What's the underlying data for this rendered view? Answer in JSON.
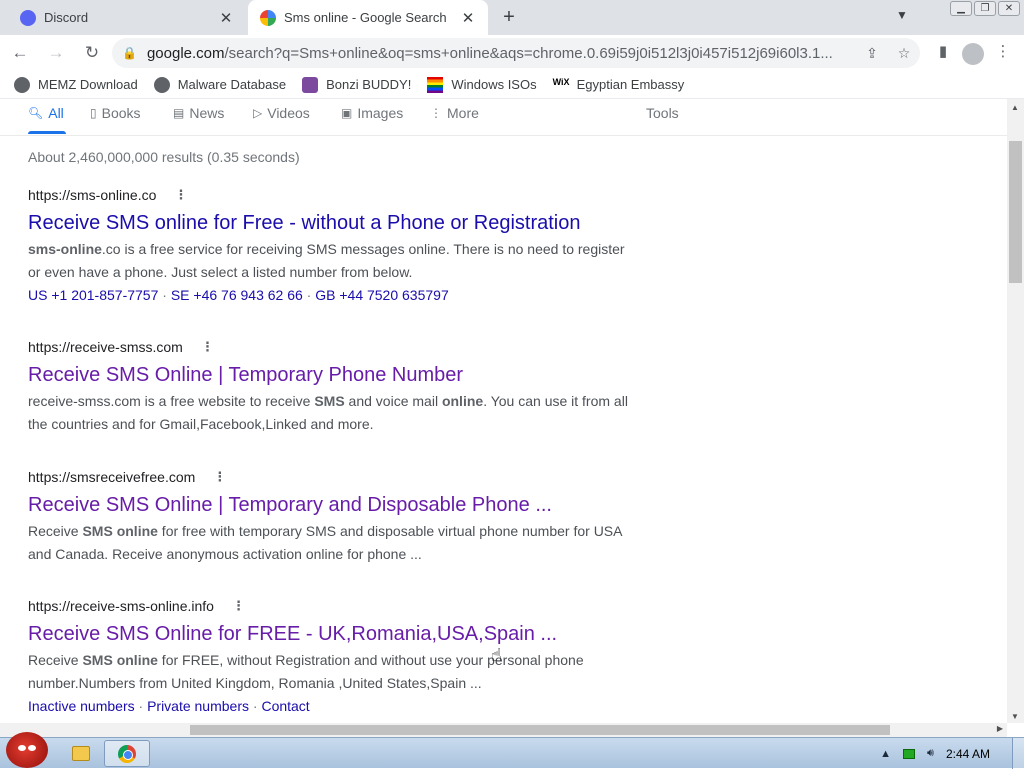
{
  "browser": {
    "tabs": [
      {
        "title": "Discord",
        "icon": "discord-icon",
        "active": false
      },
      {
        "title": "Sms online - Google Search",
        "icon": "google-icon",
        "active": true
      }
    ],
    "new_tab_label": "+",
    "omnibox": {
      "host": "google.com",
      "rest": "/search?q=Sms+online&oq=sms+online&aqs=chrome.0.69i59j0i512l3j0i457i512j69i60l3.1..."
    },
    "bookmarks": [
      {
        "label": "MEMZ Download",
        "icon": "globe-icon"
      },
      {
        "label": "Malware Database",
        "icon": "globe-icon"
      },
      {
        "label": "Bonzi BUDDY!",
        "icon": "bonzi-icon"
      },
      {
        "label": "Windows ISOs",
        "icon": "rainbow-flag-icon"
      },
      {
        "label": "Egyptian Embassy",
        "icon": "wix-icon",
        "icon_text": "WiX"
      }
    ]
  },
  "search": {
    "tabs": [
      {
        "label": "All",
        "icon": "search-icon",
        "selected": true
      },
      {
        "label": "Books",
        "icon": "book-icon",
        "selected": false
      },
      {
        "label": "News",
        "icon": "newspaper-icon",
        "selected": false
      },
      {
        "label": "Videos",
        "icon": "play-icon",
        "selected": false
      },
      {
        "label": "Images",
        "icon": "image-icon",
        "selected": false
      },
      {
        "label": "More",
        "icon": "more-icon",
        "selected": false
      }
    ],
    "tools_label": "Tools",
    "stats": "About 2,460,000,000 results (0.35 seconds)",
    "results": [
      {
        "cite": "https://sms-online.co",
        "title": "Receive SMS online for Free - without a Phone or Registration",
        "visited": false,
        "snippet_parts": [
          {
            "t": "sms-online",
            "b": true
          },
          {
            "t": ".co is a free service for receiving SMS messages online. There is no need to register or even have a phone. Just select a listed number from below.",
            "b": false
          }
        ],
        "sitelinks": [
          "US +1 201-857-7757",
          "SE +46 76 943 62 66",
          "GB +44 7520 635797"
        ]
      },
      {
        "cite": "https://receive-smss.com",
        "title": "Receive SMS Online | Temporary Phone Number",
        "visited": true,
        "snippet_parts": [
          {
            "t": "receive-smss.com is a free website to receive ",
            "b": false
          },
          {
            "t": "SMS",
            "b": true
          },
          {
            "t": " and voice mail ",
            "b": false
          },
          {
            "t": "online",
            "b": true
          },
          {
            "t": ". You can use it from all the countries and for Gmail,Facebook,Linked and more.",
            "b": false
          }
        ],
        "sitelinks": []
      },
      {
        "cite": "https://smsreceivefree.com",
        "title": "Receive SMS Online | Temporary and Disposable Phone ...",
        "visited": true,
        "snippet_parts": [
          {
            "t": "Receive ",
            "b": false
          },
          {
            "t": "SMS online",
            "b": true
          },
          {
            "t": " for free with temporary SMS and disposable virtual phone number for USA and Canada. Receive anonymous activation online for phone ...",
            "b": false
          }
        ],
        "sitelinks": []
      },
      {
        "cite": "https://receive-sms-online.info",
        "title": "Receive SMS Online for FREE - UK,Romania,USA,Spain ...",
        "visited": true,
        "snippet_parts": [
          {
            "t": "Receive ",
            "b": false
          },
          {
            "t": "SMS online",
            "b": true
          },
          {
            "t": " for FREE, without Registration and without use your personal phone number.Numbers from United Kingdom, Romania ,United States,Spain ...",
            "b": false
          }
        ],
        "sitelinks": [
          "Inactive numbers",
          "Private numbers",
          "Contact"
        ]
      }
    ]
  },
  "taskbar": {
    "clock": "2:44 AM"
  }
}
